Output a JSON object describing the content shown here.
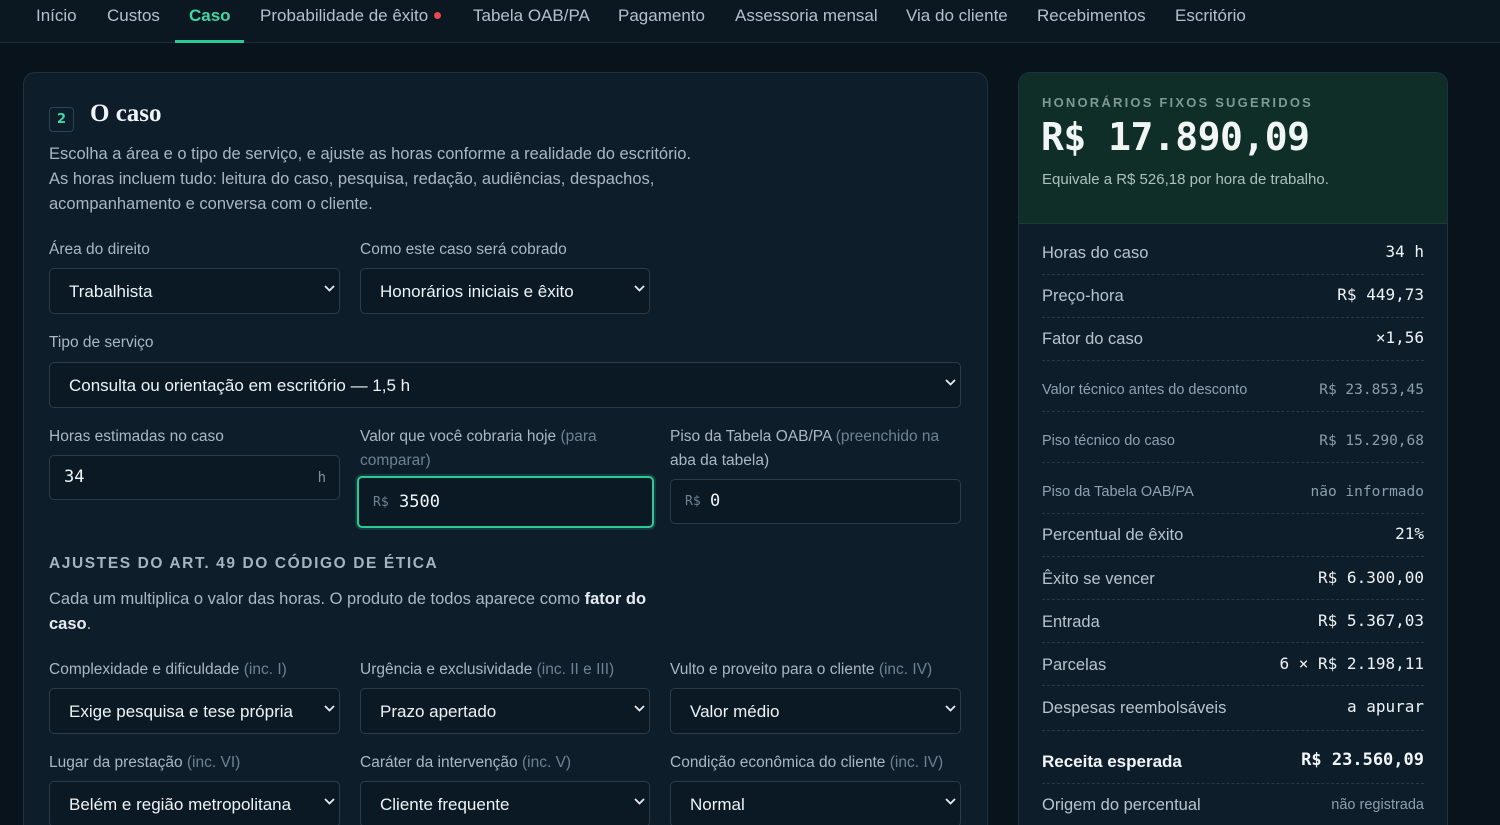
{
  "nav": {
    "tabs": [
      {
        "label": "Início"
      },
      {
        "label": "Custos"
      },
      {
        "label": "Caso"
      },
      {
        "label": "Probabilidade de êxito"
      },
      {
        "label": "Tabela OAB/PA"
      },
      {
        "label": "Pagamento"
      },
      {
        "label": "Assessoria mensal"
      },
      {
        "label": "Via do cliente"
      },
      {
        "label": "Recebimentos"
      },
      {
        "label": "Escritório"
      }
    ],
    "active_tab": "Caso",
    "accent_color": "#2ec995",
    "alert_dot_color": "#e5484d"
  },
  "case": {
    "step_number": "2",
    "title": "O caso",
    "intro_lines": [
      "Escolha a área e o tipo de serviço, e ajuste as horas conforme a realidade do escritório.",
      "As horas incluem tudo: leitura do caso, pesquisa, redação, audiências, despachos,",
      "acompanhamento e conversa com o cliente."
    ],
    "area": {
      "label": "Área do direito",
      "value": "Trabalhista"
    },
    "billing": {
      "label": "Como este caso será cobrado",
      "value": "Honorários iniciais e êxito"
    },
    "service": {
      "label": "Tipo de serviço",
      "value": "Consulta ou orientação em escritório — 1,5 h"
    },
    "hours": {
      "label": "Horas estimadas no caso",
      "value": "34",
      "suffix": "h"
    },
    "current_price": {
      "label": "Valor que você cobraria hoje",
      "label_hint_line1": "(para",
      "label_line2": "comparar)",
      "prefix": "R$",
      "value": "3500"
    },
    "oab_floor": {
      "label": "Piso da Tabela OAB/PA",
      "label_hint_line1": "(preenchido na",
      "label_line2": "aba da tabela)",
      "prefix": "R$",
      "value": "0"
    }
  },
  "adjustments": {
    "heading": "AJUSTES DO ART. 49 DO CÓDIGO DE ÉTICA",
    "desc_line1_pre": "Cada um multiplica o valor das horas. O produto de todos aparece como",
    "desc_bold1": "fator do",
    "desc_bold2": "caso",
    "desc_line2_post": ".",
    "fields": [
      {
        "label": "Complexidade e dificuldade",
        "hint": "(inc. I)",
        "value": "Exige pesquisa e tese própria"
      },
      {
        "label": "Urgência e exclusividade",
        "hint": "(inc. II e III)",
        "value": "Prazo apertado"
      },
      {
        "label": "Vulto e proveito para o cliente",
        "hint": "(inc. IV)",
        "value": "Valor médio"
      },
      {
        "label": "Lugar da prestação",
        "hint": "(inc. VI)",
        "value": "Belém e região metropolitana"
      },
      {
        "label": "Caráter da intervenção",
        "hint": "(inc. V)",
        "value": "Cliente frequente"
      },
      {
        "label": "Condição econômica do cliente",
        "hint": "(inc. IV)",
        "value": "Normal"
      }
    ]
  },
  "summary": {
    "hero_label": "HONORÁRIOS FIXOS SUGERIDOS",
    "hero_value": "R$ 17.890,09",
    "hero_sub": "Equivale a R$ 526,18 por hora de trabalho.",
    "rows": [
      {
        "key": "Horas do caso",
        "value": "34 h"
      },
      {
        "key": "Preço-hora",
        "value": "R$ 449,73"
      },
      {
        "key": "Fator do caso",
        "value": "×1,56"
      },
      {
        "key": "Valor técnico antes do desconto",
        "value": "R$ 23.853,45"
      },
      {
        "key": "Piso técnico do caso",
        "value": "R$ 15.290,68"
      },
      {
        "key": "Piso da Tabela OAB/PA",
        "value": "não informado"
      },
      {
        "key": "Percentual de êxito",
        "value": "21%"
      },
      {
        "key": "Êxito se vencer",
        "value": "R$ 6.300,00"
      },
      {
        "key": "Entrada",
        "value": "R$ 5.367,03"
      },
      {
        "key": "Parcelas",
        "value": "6 × R$ 2.198,11"
      },
      {
        "key": "Despesas reembolsáveis",
        "value": "a apurar"
      },
      {
        "key": "Receita esperada",
        "value": "R$ 23.560,09"
      },
      {
        "key": "Origem do percentual",
        "value": "não registrada"
      }
    ]
  }
}
